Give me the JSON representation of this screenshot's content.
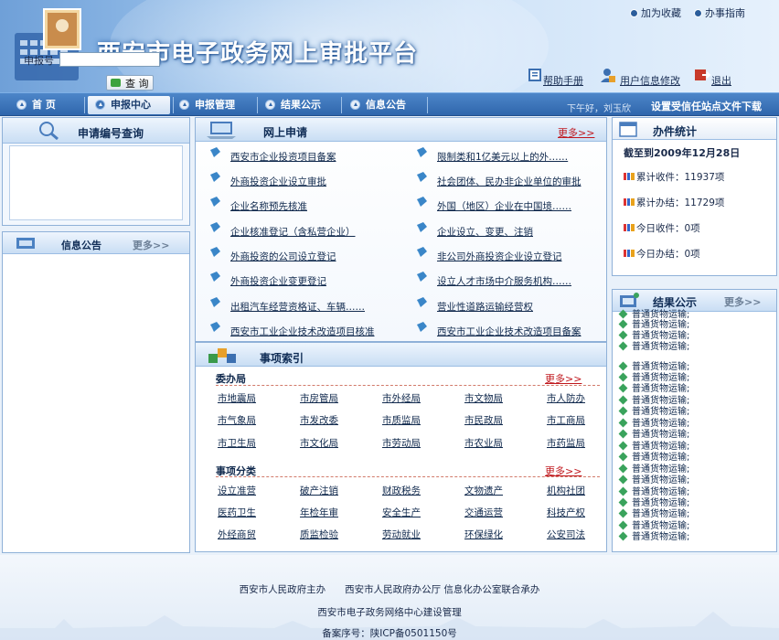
{
  "header": {
    "title": "西安市电子政务网上审批平台",
    "top_links": [
      "加为收藏",
      "办事指南"
    ],
    "help_links": [
      "帮助手册",
      "用户信息修改",
      "退出"
    ]
  },
  "nav": {
    "items": [
      "首 页",
      "申报中心",
      "申报管理",
      "结果公示",
      "信息公告"
    ],
    "greeting": "下午好，刘玉欣",
    "trust_link": "设置受信任站点文件下载"
  },
  "query": {
    "title": "申请编号查询",
    "label": "申报号",
    "input_value": "",
    "button": "查 询"
  },
  "notice": {
    "title": "信息公告",
    "more": "更多>>"
  },
  "online": {
    "title": "网上申请",
    "more": "更多>>",
    "left": [
      "西安市企业投资项目备案",
      "外商投资企业设立审批",
      "企业名称预先核准",
      "企业核准登记（含私营企业）",
      "外商投资的公司设立登记",
      "外商投资企业变更登记",
      "出租汽车经营资格证、车辆……",
      "西安市工业企业技术改造项目核准"
    ],
    "right": [
      "限制类和1亿美元以上的外……",
      "社会团体、民办非企业单位的审批",
      "外国（地区）企业在中国境……",
      "企业设立、变更、注销",
      "非公司外商投资企业设立登记",
      "设立人才市场中介服务机构……",
      "营业性道路运输经营权",
      "西安市工业企业技术改造项目备案"
    ]
  },
  "index": {
    "title": "事项索引",
    "bureau": {
      "title": "委办局",
      "more": "更多>>",
      "rows": [
        [
          "市地震局",
          "市房管局",
          "市外经局",
          "市文物局",
          "市人防办"
        ],
        [
          "市气象局",
          "市发改委",
          "市质监局",
          "市民政局",
          "市工商局"
        ],
        [
          "市卫生局",
          "市文化局",
          "市劳动局",
          "市农业局",
          "市药监局"
        ]
      ]
    },
    "category": {
      "title": "事项分类",
      "more": "更多>>",
      "rows": [
        [
          "设立准营",
          "破产注销",
          "财政税务",
          "文物遗产",
          "机构社团"
        ],
        [
          "医药卫生",
          "年检年审",
          "安全生产",
          "交通运营",
          "科技产权"
        ],
        [
          "外经商贸",
          "质监检验",
          "劳动就业",
          "环保绿化",
          "公安司法"
        ]
      ]
    }
  },
  "stats": {
    "title": "办件统计",
    "date_line": "截至到2009年12月28日",
    "items": [
      "累计收件：11937项",
      "累计办结：11729项",
      "今日收件：0项",
      "今日办结：0项"
    ]
  },
  "results": {
    "title": "结果公示",
    "more": "更多>>",
    "item_text": "普通货物运输;",
    "items": [
      "普通货物运输;",
      "普通货物运输;",
      "普通货物运输;",
      "普通货物运输;",
      "普通货物运输;",
      "普通货物运输;",
      "普通货物运输;",
      "普通货物运输;",
      "普通货物运输;",
      "普通货物运输;",
      "普通货物运输;",
      "普通货物运输;",
      "普通货物运输;",
      "普通货物运输;",
      "普通货物运输;",
      "普通货物运输;",
      "普通货物运输;",
      "普通货物运输;",
      "普通货物运输;",
      "普通货物运输;"
    ]
  },
  "footer": {
    "line1": "西安市人民政府主办　　西安市人民政府办公厅 信息化办公室联合承办",
    "line2": "西安市电子政务网络中心建设管理",
    "line3": "备案序号：陕ICP备0501150号"
  },
  "colors": {
    "nav_blue": "#2f66ac",
    "more_red": "#c0181e",
    "title_white": "#ffffff"
  }
}
